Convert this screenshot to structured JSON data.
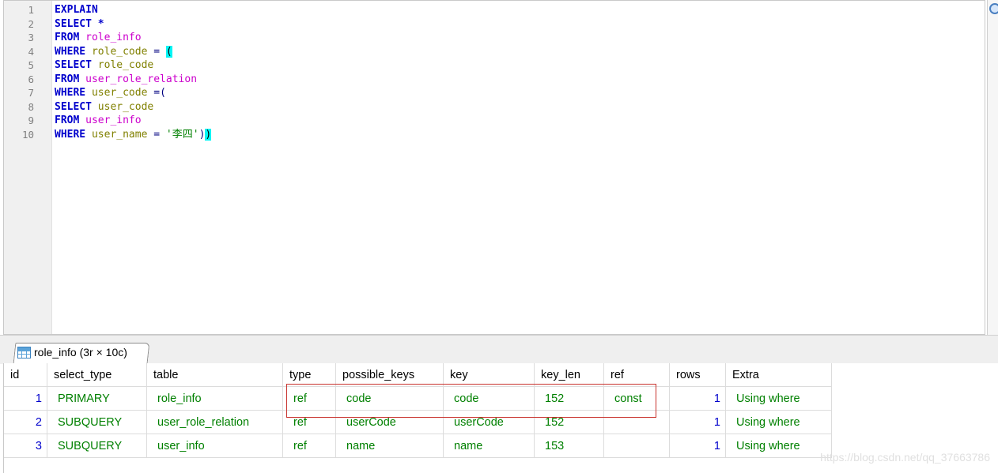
{
  "editor": {
    "line_numbers": [
      "1",
      "2",
      "3",
      "4",
      "5",
      "6",
      "7",
      "8",
      "9",
      "10"
    ]
  },
  "result_tab": {
    "label": "role_info (3r × 10c)",
    "icon": "table-grid-icon"
  },
  "results": {
    "columns": [
      "id",
      "select_type",
      "table",
      "type",
      "possible_keys",
      "key",
      "key_len",
      "ref",
      "rows",
      "Extra"
    ],
    "rows": [
      {
        "id": "1",
        "select_type": "PRIMARY",
        "table": "role_info",
        "type": "ref",
        "possible_keys": "code",
        "key": "code",
        "key_len": "152",
        "ref": "const",
        "rows": "1",
        "extra": "Using where"
      },
      {
        "id": "2",
        "select_type": "SUBQUERY",
        "table": "user_role_relation",
        "type": "ref",
        "possible_keys": "userCode",
        "key": "userCode",
        "key_len": "152",
        "ref": "",
        "rows": "1",
        "extra": "Using where"
      },
      {
        "id": "3",
        "select_type": "SUBQUERY",
        "table": "user_info",
        "type": "ref",
        "possible_keys": "name",
        "key": "name",
        "key_len": "153",
        "ref": "",
        "rows": "1",
        "extra": "Using where"
      }
    ]
  },
  "watermark": "https://blog.csdn.net/qq_37663786",
  "colors": {
    "keyword": "#0000cc",
    "table_name": "#cc00cc",
    "column_name": "#808000",
    "string": "#008000",
    "bracket_highlight": "#00f5f5",
    "highlight_box": "#c8322d"
  }
}
